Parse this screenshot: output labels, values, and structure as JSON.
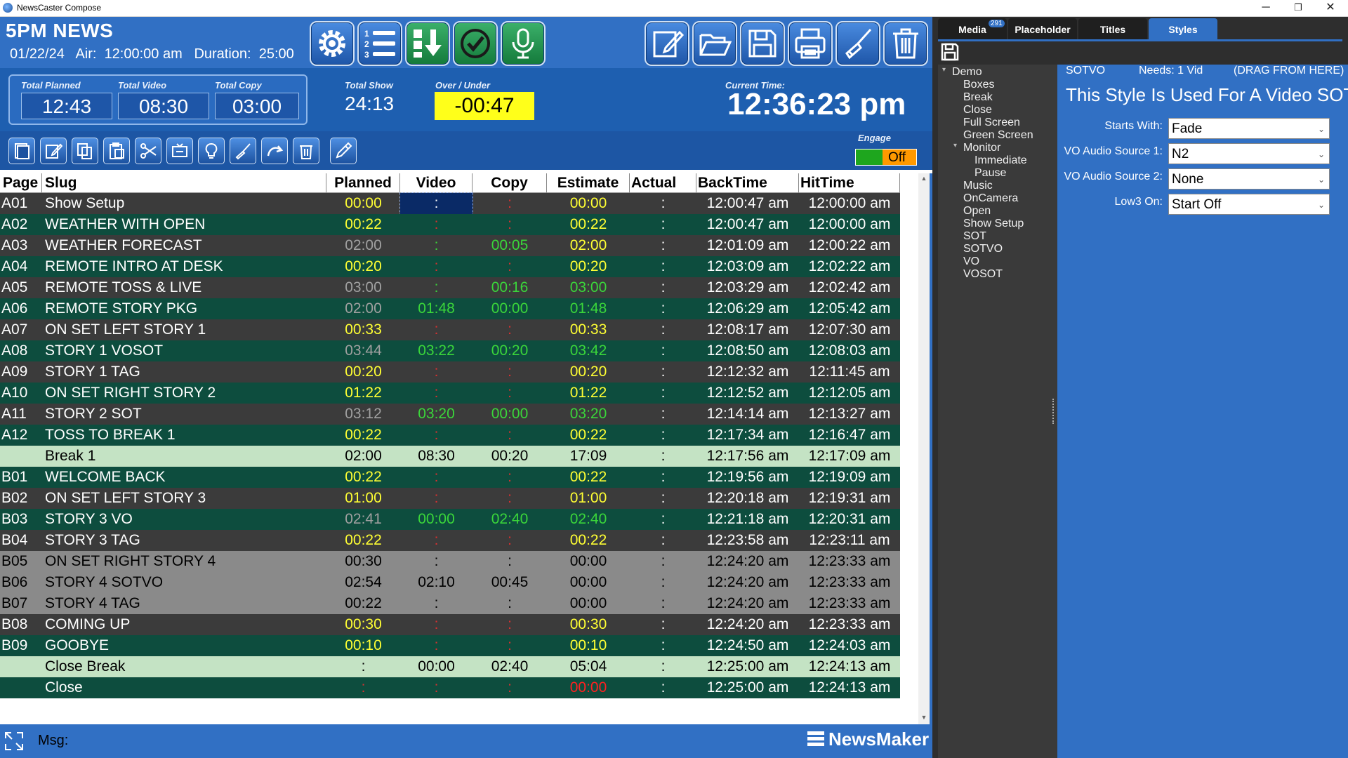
{
  "window": {
    "title": "NewsCaster Compose",
    "min": "─",
    "max": "❐",
    "close": "✕"
  },
  "header": {
    "show": "5PM NEWS",
    "date": "01/22/24",
    "air_label": "Air:",
    "air_time": "12:00:00 am",
    "duration_label": "Duration:",
    "duration": "25:00"
  },
  "toolbar_main": [
    "settings-gear",
    "numbered-list",
    "download-arrow",
    "check-circle",
    "microphone"
  ],
  "toolbar_file": [
    "edit-note",
    "open-folder",
    "save-disk",
    "print",
    "brush-clean",
    "trash"
  ],
  "totals": {
    "planned_label": "Total Planned",
    "planned": "12:43",
    "video_label": "Total Video",
    "video": "08:30",
    "copy_label": "Total Copy",
    "copy": "03:00",
    "show_label": "Total Show",
    "show": "24:13",
    "overunder_label": "Over / Under",
    "overunder": "-00:47",
    "current_label": "Current Time:",
    "current": "12:36:23 pm",
    "engage_label": "Engage",
    "engage_state": "Off"
  },
  "columns": [
    "Page",
    "Slug",
    "Planned",
    "Video",
    "Copy",
    "Estimate",
    "Actual",
    "BackTime",
    "HitTime"
  ],
  "rows": [
    {
      "page": "A01",
      "slug": "Show Setup",
      "planned": "00:00",
      "video": ":",
      "copy": ":",
      "est": "00:00",
      "actual": ":",
      "back": "12:00:47 am",
      "hit": "12:00:00 am",
      "bg": "#3b3b3b",
      "pc": "#ffff33",
      "vc": "#ffffff",
      "cc": "#d93030",
      "ec": "#ffff33"
    },
    {
      "page": "A02",
      "slug": "WEATHER WITH OPEN",
      "planned": "00:22",
      "video": ":",
      "copy": ":",
      "est": "00:22",
      "actual": ":",
      "back": "12:00:47 am",
      "hit": "12:00:00 am",
      "bg": "#0d4d3e",
      "pc": "#ffff33",
      "vc": "#d93030",
      "cc": "#d93030",
      "ec": "#ffff33"
    },
    {
      "page": "A03",
      "slug": "WEATHER FORECAST",
      "planned": "02:00",
      "video": ":",
      "copy": "00:05",
      "est": "02:00",
      "actual": ":",
      "back": "12:01:09 am",
      "hit": "12:00:22 am",
      "bg": "#3b3b3b",
      "pc": "#a0a0a0",
      "vc": "#3ad63a",
      "cc": "#3ad63a",
      "ec": "#ffff33"
    },
    {
      "page": "A04",
      "slug": "REMOTE INTRO AT DESK",
      "planned": "00:20",
      "video": ":",
      "copy": ":",
      "est": "00:20",
      "actual": ":",
      "back": "12:03:09 am",
      "hit": "12:02:22 am",
      "bg": "#0d4d3e",
      "pc": "#ffff33",
      "vc": "#d93030",
      "cc": "#d93030",
      "ec": "#ffff33"
    },
    {
      "page": "A05",
      "slug": "REMOTE TOSS & LIVE",
      "planned": "03:00",
      "video": ":",
      "copy": "00:16",
      "est": "03:00",
      "actual": ":",
      "back": "12:03:29 am",
      "hit": "12:02:42 am",
      "bg": "#3b3b3b",
      "pc": "#a0a0a0",
      "vc": "#3ad63a",
      "cc": "#3ad63a",
      "ec": "#3ad63a"
    },
    {
      "page": "A06",
      "slug": "REMOTE STORY PKG",
      "planned": "02:00",
      "video": "01:48",
      "copy": "00:00",
      "est": "01:48",
      "actual": ":",
      "back": "12:06:29 am",
      "hit": "12:05:42 am",
      "bg": "#0d4d3e",
      "pc": "#a0a0a0",
      "vc": "#3ad63a",
      "cc": "#3ad63a",
      "ec": "#3ad63a"
    },
    {
      "page": "A07",
      "slug": "ON SET LEFT STORY 1",
      "planned": "00:33",
      "video": ":",
      "copy": ":",
      "est": "00:33",
      "actual": ":",
      "back": "12:08:17 am",
      "hit": "12:07:30 am",
      "bg": "#3b3b3b",
      "pc": "#ffff33",
      "vc": "#d93030",
      "cc": "#d93030",
      "ec": "#ffff33"
    },
    {
      "page": "A08",
      "slug": "STORY 1 VOSOT",
      "planned": "03:44",
      "video": "03:22",
      "copy": "00:20",
      "est": "03:42",
      "actual": ":",
      "back": "12:08:50 am",
      "hit": "12:08:03 am",
      "bg": "#0d4d3e",
      "pc": "#a0a0a0",
      "vc": "#3ad63a",
      "cc": "#3ad63a",
      "ec": "#3ad63a"
    },
    {
      "page": "A09",
      "slug": "STORY 1 TAG",
      "planned": "00:20",
      "video": ":",
      "copy": ":",
      "est": "00:20",
      "actual": ":",
      "back": "12:12:32 am",
      "hit": "12:11:45 am",
      "bg": "#3b3b3b",
      "pc": "#ffff33",
      "vc": "#d93030",
      "cc": "#d93030",
      "ec": "#ffff33"
    },
    {
      "page": "A10",
      "slug": "ON SET RIGHT STORY 2",
      "planned": "01:22",
      "video": ":",
      "copy": ":",
      "est": "01:22",
      "actual": ":",
      "back": "12:12:52 am",
      "hit": "12:12:05 am",
      "bg": "#0d4d3e",
      "pc": "#ffff33",
      "vc": "#d93030",
      "cc": "#d93030",
      "ec": "#ffff33"
    },
    {
      "page": "A11",
      "slug": "STORY 2 SOT",
      "planned": "03:12",
      "video": "03:20",
      "copy": "00:00",
      "est": "03:20",
      "actual": ":",
      "back": "12:14:14 am",
      "hit": "12:13:27 am",
      "bg": "#3b3b3b",
      "pc": "#a0a0a0",
      "vc": "#3ad63a",
      "cc": "#3ad63a",
      "ec": "#3ad63a"
    },
    {
      "page": "A12",
      "slug": "TOSS TO BREAK 1",
      "planned": "00:22",
      "video": ":",
      "copy": ":",
      "est": "00:22",
      "actual": ":",
      "back": "12:17:34 am",
      "hit": "12:16:47 am",
      "bg": "#0d4d3e",
      "pc": "#ffff33",
      "vc": "#d93030",
      "cc": "#d93030",
      "ec": "#ffff33"
    },
    {
      "page": "",
      "slug": "Break 1",
      "planned": "02:00",
      "video": "08:30",
      "copy": "00:20",
      "est": "17:09",
      "actual": ":",
      "back": "12:17:56 am",
      "hit": "12:17:09 am",
      "bg": "#c4e3c4",
      "pc": "#000000",
      "vc": "#000000",
      "cc": "#000000",
      "ec": "#000000",
      "fg": "#000000"
    },
    {
      "page": "B01",
      "slug": "WELCOME BACK",
      "planned": "00:22",
      "video": ":",
      "copy": ":",
      "est": "00:22",
      "actual": ":",
      "back": "12:19:56 am",
      "hit": "12:19:09 am",
      "bg": "#0d4d3e",
      "pc": "#ffff33",
      "vc": "#d93030",
      "cc": "#d93030",
      "ec": "#ffff33"
    },
    {
      "page": "B02",
      "slug": "ON SET LEFT STORY 3",
      "planned": "01:00",
      "video": ":",
      "copy": ":",
      "est": "01:00",
      "actual": ":",
      "back": "12:20:18 am",
      "hit": "12:19:31 am",
      "bg": "#3b3b3b",
      "pc": "#ffff33",
      "vc": "#d93030",
      "cc": "#d93030",
      "ec": "#ffff33"
    },
    {
      "page": "B03",
      "slug": "STORY 3 VO",
      "planned": "02:41",
      "video": "00:00",
      "copy": "02:40",
      "est": "02:40",
      "actual": ":",
      "back": "12:21:18 am",
      "hit": "12:20:31 am",
      "bg": "#0d4d3e",
      "pc": "#a0a0a0",
      "vc": "#3ad63a",
      "cc": "#3ad63a",
      "ec": "#3ad63a"
    },
    {
      "page": "B04",
      "slug": "STORY 3 TAG",
      "planned": "00:22",
      "video": ":",
      "copy": ":",
      "est": "00:22",
      "actual": ":",
      "back": "12:23:58 am",
      "hit": "12:23:11 am",
      "bg": "#3b3b3b",
      "pc": "#ffff33",
      "vc": "#d93030",
      "cc": "#d93030",
      "ec": "#ffff33"
    },
    {
      "page": "B05",
      "slug": "ON SET RIGHT STORY 4",
      "planned": "00:30",
      "video": ":",
      "copy": ":",
      "est": "00:00",
      "actual": ":",
      "back": "12:24:20 am",
      "hit": "12:23:33 am",
      "bg": "#8a8a8a",
      "pc": "#000000",
      "vc": "#000000",
      "cc": "#000000",
      "ec": "#000000",
      "fg": "#000000"
    },
    {
      "page": "B06",
      "slug": "STORY 4 SOTVO",
      "planned": "02:54",
      "video": "02:10",
      "copy": "00:45",
      "est": "00:00",
      "actual": ":",
      "back": "12:24:20 am",
      "hit": "12:23:33 am",
      "bg": "#8a8a8a",
      "pc": "#000000",
      "vc": "#000000",
      "cc": "#000000",
      "ec": "#000000",
      "fg": "#000000"
    },
    {
      "page": "B07",
      "slug": "STORY 4 TAG",
      "planned": "00:22",
      "video": ":",
      "copy": ":",
      "est": "00:00",
      "actual": ":",
      "back": "12:24:20 am",
      "hit": "12:23:33 am",
      "bg": "#8a8a8a",
      "pc": "#000000",
      "vc": "#000000",
      "cc": "#000000",
      "ec": "#000000",
      "fg": "#000000"
    },
    {
      "page": "B08",
      "slug": "COMING UP",
      "planned": "00:30",
      "video": ":",
      "copy": ":",
      "est": "00:30",
      "actual": ":",
      "back": "12:24:20 am",
      "hit": "12:23:33 am",
      "bg": "#3b3b3b",
      "pc": "#ffff33",
      "vc": "#d93030",
      "cc": "#d93030",
      "ec": "#ffff33"
    },
    {
      "page": "B09",
      "slug": "GOOBYE",
      "planned": "00:10",
      "video": ":",
      "copy": ":",
      "est": "00:10",
      "actual": ":",
      "back": "12:24:50 am",
      "hit": "12:24:03 am",
      "bg": "#0d4d3e",
      "pc": "#ffff33",
      "vc": "#d93030",
      "cc": "#d93030",
      "ec": "#ffff33"
    },
    {
      "page": "",
      "slug": "Close Break",
      "planned": ":",
      "video": "00:00",
      "copy": "02:40",
      "est": "05:04",
      "actual": ":",
      "back": "12:25:00 am",
      "hit": "12:24:13 am",
      "bg": "#c4e3c4",
      "pc": "#000000",
      "vc": "#000000",
      "cc": "#000000",
      "ec": "#000000",
      "fg": "#000000"
    },
    {
      "page": "",
      "slug": "Close",
      "planned": ":",
      "video": ":",
      "copy": ":",
      "est": "00:00",
      "actual": ":",
      "back": "12:25:00 am",
      "hit": "12:24:13 am",
      "bg": "#0d4d3e",
      "pc": "#d93030",
      "vc": "#d93030",
      "cc": "#d93030",
      "ec": "#ff2020"
    }
  ],
  "status": {
    "msg_label": "Msg:",
    "brand": "NewsMaker"
  },
  "right": {
    "tabs": [
      {
        "label": "Media",
        "badge": "291"
      },
      {
        "label": "Placeholder"
      },
      {
        "label": "Titles"
      },
      {
        "label": "Styles",
        "active": true
      }
    ],
    "tree": [
      {
        "label": "Demo",
        "level": 0,
        "expanded": true
      },
      {
        "label": "Boxes",
        "level": 1
      },
      {
        "label": "Break",
        "level": 1
      },
      {
        "label": "Close",
        "level": 1
      },
      {
        "label": "Full Screen",
        "level": 1
      },
      {
        "label": "Green Screen",
        "level": 1
      },
      {
        "label": "Monitor",
        "level": 1,
        "expanded": true
      },
      {
        "label": "Immediate",
        "level": 2
      },
      {
        "label": "Pause",
        "level": 2
      },
      {
        "label": "Music",
        "level": 1
      },
      {
        "label": "OnCamera",
        "level": 1
      },
      {
        "label": "Open",
        "level": 1
      },
      {
        "label": "Show Setup",
        "level": 1
      },
      {
        "label": "SOT",
        "level": 1
      },
      {
        "label": "SOTVO",
        "level": 1
      },
      {
        "label": "VO",
        "level": 1
      },
      {
        "label": "VOSOT",
        "level": 1
      }
    ],
    "style_name": "SOTVO",
    "needs": "Needs: 1 Vid",
    "drag_hint": "(DRAG FROM HERE)",
    "description": "This Style Is Used For A Video SOT",
    "fields": [
      {
        "label": "Starts With:",
        "value": "Fade"
      },
      {
        "label": "VO Audio Source 1:",
        "value": "N2"
      },
      {
        "label": "VO Audio Source 2:",
        "value": "None"
      },
      {
        "label": "Low3 On:",
        "value": "Start Off"
      }
    ]
  }
}
